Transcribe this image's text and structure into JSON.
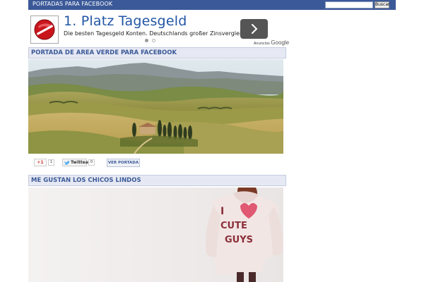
{
  "header": {
    "site_title": "PORTADAS PARA FACEBOOK",
    "search_placeholder": "",
    "search_button": "Buscar"
  },
  "ad": {
    "headline": "1. Platz Tagesgeld",
    "text": "Die besten Tagesgeld Konten. Deutschlands großer Zinsvergleich!",
    "attribution_prefix": "Anuncios",
    "attribution_brand": "Google",
    "carousel_pages": 2,
    "carousel_active": 1
  },
  "posts": [
    {
      "title": "PORTADA DE AREA VERDE PARA FACEBOOK",
      "gplus_label": "+1",
      "gplus_count": "1",
      "tweet_label": "Twittear",
      "tweet_count": "0",
      "view_label": "VER PORTADA"
    },
    {
      "title": "ME GUSTAN LOS CHICOS LINDOS"
    }
  ],
  "colors": {
    "header_bg": "#3b5998",
    "section_title": "#3b5998",
    "section_bg": "#e6e9f3",
    "ad_headline": "#2156a5"
  }
}
